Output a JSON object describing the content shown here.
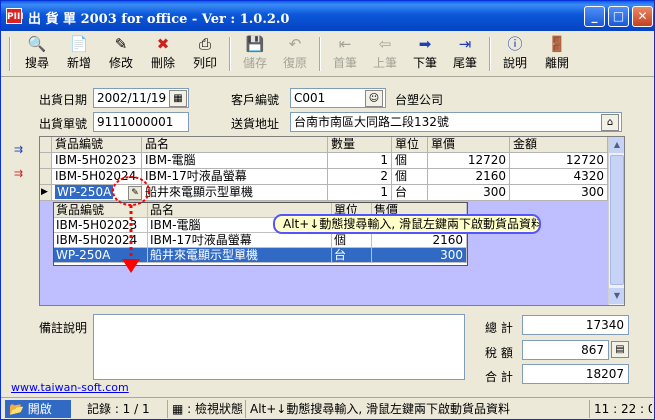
{
  "window": {
    "title": "出 貨 單 2003 for office - Ver : 1.0.2.0",
    "app_icon": "PIII"
  },
  "toolbar": {
    "search": "搜尋",
    "add": "新增",
    "edit": "修改",
    "delete": "刪除",
    "print": "列印",
    "save": "儲存",
    "restore": "復原",
    "first": "首筆",
    "prev": "上筆",
    "next": "下筆",
    "last": "尾筆",
    "help": "說明",
    "exit": "離開"
  },
  "form": {
    "ship_date_label": "出貨日期",
    "ship_date": "2002/11/19",
    "cust_no_label": "客戶編號",
    "cust_no": "C001",
    "cust_name": "台塑公司",
    "ship_no_label": "出貨單號",
    "ship_no": "9111000001",
    "address_label": "送貨地址",
    "address": "台南市南區大同路二段132號"
  },
  "grid": {
    "headers": [
      "貨品編號",
      "品名",
      "數量",
      "單位",
      "單價",
      "金額"
    ],
    "rows": [
      [
        "IBM-5H02023",
        "IBM-電腦",
        "1",
        "個",
        "12720",
        "12720"
      ],
      [
        "IBM-5H02024",
        "IBM-17吋液晶螢幕",
        "2",
        "個",
        "2160",
        "4320"
      ],
      [
        "WP-250A",
        "船井來電顯示型單機",
        "1",
        "台",
        "300",
        "300"
      ]
    ]
  },
  "lookup": {
    "headers": [
      "貨品編號",
      "品名",
      "單位",
      "售價"
    ],
    "rows": [
      [
        "IBM-5H02023",
        "IBM-電腦",
        "",
        ""
      ],
      [
        "IBM-5H02024",
        "IBM-17吋液晶螢幕",
        "個",
        "2160"
      ],
      [
        "WP-250A",
        "船井來電顯示型單機",
        "台",
        "300"
      ]
    ]
  },
  "tooltip": "Alt+↓動態搜尋輸入, 滑鼠左鍵兩下啟動貨品資料",
  "notes_label": "備註說明",
  "totals": {
    "total_label": "總 計",
    "total": "17340",
    "tax_label": "稅 額",
    "tax": "867",
    "grand_label": "合 計",
    "grand": "18207"
  },
  "link": "www.taiwan-soft.com",
  "status": {
    "start": "開啟",
    "record": "記錄 : 1 / 1",
    "mode": "檢視狀態",
    "hint": "Alt+↓動態搜尋輸入, 滑鼠左鍵兩下啟動貨品資料",
    "time": "11 : 22 : 01"
  },
  "icons": [
    "search-icon",
    "add-icon",
    "edit-icon",
    "delete-icon",
    "print-icon",
    "save-icon",
    "restore-icon",
    "first-icon",
    "prev-icon",
    "next-icon",
    "last-icon",
    "help-icon",
    "exit-icon",
    "calendar-icon",
    "customer-icon",
    "home-icon",
    "calculator-icon"
  ],
  "colors": {
    "titlebar": "#0a58d9",
    "selection": "#316ac5",
    "grid_bg": "#bfbfff",
    "tooltip_border": "#5555ff",
    "arrow": "#ff0000"
  }
}
